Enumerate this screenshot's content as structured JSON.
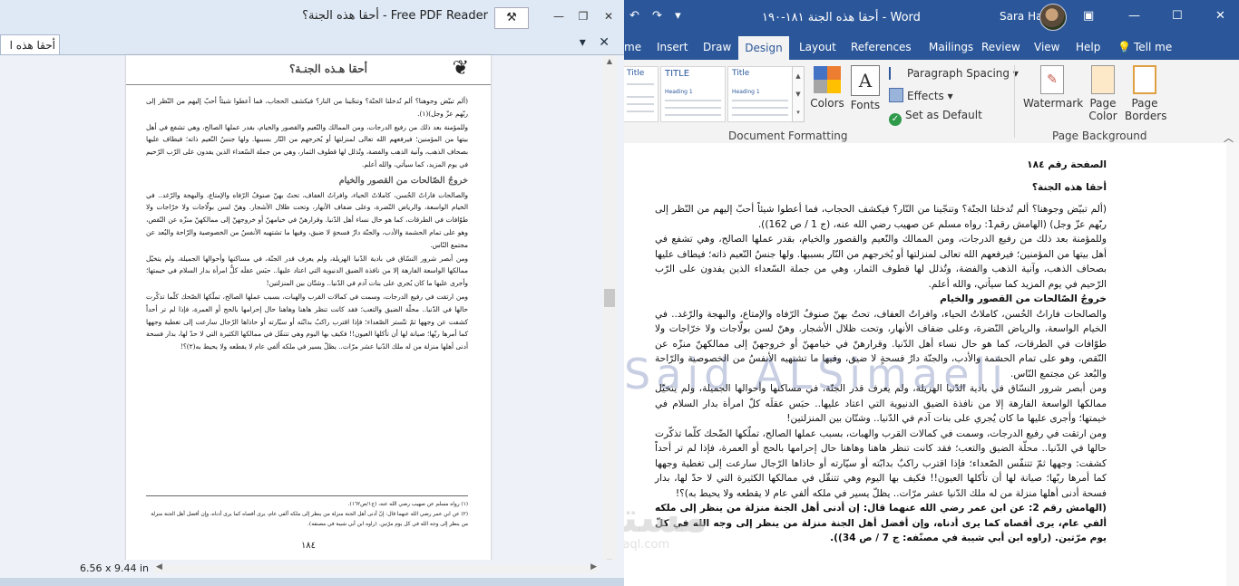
{
  "pdf": {
    "window_title": "أحقا هذه الجنة؟ - Free PDF Reader",
    "tab_label": "أحقا هذه ا",
    "page_header": "أحقا هـذه الجنـة؟",
    "paragraphs": [
      "(ألم تبيّض وجوهنا؟ ألم تُدخلنا الجنّة؟ وتنجّينا من النار؟ فيكشف الحجاب، فما أعطوا شيئاً أحبّ إليهم من النّظر إلى ربّهم عزّ وجل)(١).",
      "وللمؤمنة بعد ذلك من رفيع الدرجات، ومن الممالك والنّعيم والقصور والخيام، بقدر عملها الصالح، وهي تشفع في أهل بيتها من المؤمنين؛ فيرفعهم الله تعالى لمنزلتها أو يُخرجهم من النّار بسببها. ولها جنسُ النّعيم ذاته؛ فيطاف عليها بصحاف الذهب، وآنية الذهب والفضة، وتُذلل لها قطوف الثمار، وهي من جملة السّعداء الذين يفدون على الرّب الرّحيم في يوم المزيد، كما سيأتي، والله أعلم."
    ],
    "subheading": "خروجُ الصّالحات من القصور والخيام",
    "paragraphs2": [
      "والصالحات فاراتٌ الحُسن، كاملاتُ الحياء، وافراتُ العفاف، تحتُ بهنّ صنوفُ الرّفاه والإمتاع، والبهجة والرّغد.. في الخيام الواسعة، والرياض النّضرة، وعلى ضفاف الأنهار، وتحت ظلال الأشجار. وهنّ لسن بولّاجات ولا خرّاجات ولا طوّافات في الطرقات، كما هو حال نساء أهل الدّنيا. وقرارهنّ في خيامهنّ أو خروجهنّ إلى ممالكهنّ منزّه عن النّقص، وهو على تمام الحشمة والأدب، والجنّة دارُ فسحةٍ لا ضيق، وفيها ما تشتهيه الأنفسُ من الخصوصية والرّاحة والبُعد عن مجتمع النّاس.",
      "ومن أبصر شرور النسّاق في بادية الدّنيا الهزيلة، ولم يعرف قدر الجنّة، في مساكنها وأحوالها الجميلة، ولم يتخيّل ممالكها الواسعة الفارهة إلا من نافذة الضيق الدنيوية التي اعتاد عليها.. حبَس عقلَه كلُّ امرأة بدار السلام في خيمتها؛ وأجرى عليها ما كان يُجري على بنات آدم في الدّنيا.. وشتّان بين المنزلتين!",
      "ومن ارتقت في رفيع الدرجات، وسمت في كمالات القرب والهبات، بسبب عملها الصالح، تملّكها الصّحك كلّما تذكّرت حالها في الدّنيا.. محلّة الضيق والتعب؛ فقد كانت تنظر هاهنا وهاهنا حال إحرامها بالحج أو العمرة، فإذا لم تر أحداً كشفت عن وجهها ثمّ تتّستر الصّعداء؛ فإذا اقترب راكبٌ بدابّته أو سيّارته أو حاذاها الرّجال سارعت إلى تغطية وجهها كما أمرها ربّها؛ صيانة لها أن تأكلها العيون!! فكيف بها اليوم وهي تتنقّل في ممالكها الكثيرة التي لا حدّ لها، بدار فسحة أدنى أهلها منزلة من له ملك الدّنيا عشر مرّات.. يظلّ يسير في ملكه ألفي عام لا يقطعه ولا يحيط به(٢)؟!"
    ],
    "footnotes": [
      "(١) رواه مسلم عن صهيب رضي الله عنه، (ج١/ص١٦٢).",
      "(٢) عن ابن عمر رضي الله عنهما قال: إنّ أدنى أهل الجنة منزلة من ينظر إلى ملكه ألفي عام، يرى أقصاه كما يرى أدناه، وإن أفضل أهل الجنة منزلة من ينظر إلى وجه الله في كل يوم مرّتين. (راوه ابن أبي شيبة في مصنفه)."
    ],
    "page_number": "١٨٤",
    "page_size": "6.56 x 9.44 in"
  },
  "word": {
    "doc_title": "أحقا هذه الجنة ١٨١-١٩٠ - Word",
    "user_name": "Sara Hamdi",
    "ribbon_tabs": [
      "me",
      "Insert",
      "Draw",
      "Design",
      "Layout",
      "References",
      "Mailings",
      "Review",
      "View",
      "Help",
      "Tell me"
    ],
    "active_tab": "Design",
    "gallery": [
      {
        "title": "Title",
        "heading": "Heading 1"
      },
      {
        "title": "TITLE",
        "heading": "Heading 1"
      },
      {
        "title": "Title",
        "heading": "Heading 1"
      }
    ],
    "colors_label": "Colors",
    "fonts_label": "Fonts",
    "paragraph_spacing_label": "Paragraph Spacing",
    "effects_label": "Effects",
    "set_default_label": "Set as Default",
    "group_document_formatting": "Document Formatting",
    "watermark_label": "Watermark",
    "page_color_label": "Page Color",
    "page_borders_label": "Page Borders",
    "group_page_background": "Page Background",
    "watermark_text": "Said ALSimaeli",
    "mostaql_logo": "مستقل",
    "mostaql_url": "mostaql.com",
    "lines": [
      {
        "text": "الصفحة رقم ١٨٤",
        "bold": true
      },
      {
        "text": "",
        "gap": true
      },
      {
        "text": "أحقا هذه الجنة؟",
        "bold": true
      },
      {
        "text": "",
        "gap": true
      },
      {
        "text": "(ألم تبيّض وجوهنا؟ ألم تُدخلنا الجنّة؟ وتنجّينا من النّار؟ فيكشف الحجاب، فما أعطوا شيئاً أحبّ إليهم من النّظر إلى ربّهم عزّ وجل) (الهامش رقم1: رواه مسلم عن صهيب رضي الله عنه، (ج 1 / ص 162))."
      },
      {
        "text": "وللمؤمنة بعد ذلك من رفيع الدرجات، ومن الممالك والنّعيم والقصور والخيام، بقدر عملها الصالح، وهي تشفع في أهل بيتها من المؤمنين؛ فيرفعهم الله تعالى لمنزلتها أو يُخرجهم من النّار بسببها. ولها جنسُ النّعيم ذاته؛ فيطاف عليها بصحاف الذهب، وآنية الذهب والفضة، وتُذلل لها قطوف الثمار، وهي من جملة السّعداء الذين يفدون على الرّب الرّحيم في يوم المزيد كما سيأتي، والله أعلم."
      },
      {
        "text": "خروجُ الصّالحات من القصور والخيام",
        "bold": true
      },
      {
        "text": "والصالحات فاراتُ الحُسن، كاملاتُ الحياء، وافراتُ العفاف، تحتُ بهنّ صنوفُ الرّفاه والإمتاع، والبهجة والرّغد.. في الخيام الواسعة، والرياض النّضرة، وعلى ضفاف الأنهار، وتحت ظلال الأشجار. وهنّ لسن بولّاجات ولا خرّاجات ولا طوّافات في الطرقات، كما هو حال نساء أهل الدّنيا. وقرارهنّ في خيامهنّ أو خروجهنّ إلى ممالكهنّ منزّه عن النّقص، وهو على تمام الحشمة والأدب، والجنّة دارُ فسحةٍ لا ضيق، وفيها ما تشتهيه الأنفسُ من الخصوصية والرّاحة والبُعد عن مجتمع النّاس."
      },
      {
        "text": "ومن أبصر شرور النسّاق في بادية الدّنيا الهزيلة، ولم يعرف قدر الجنّة، في مساكنها وأحوالها الجميلة، ولم يتخيّل ممالكها الواسعة الفارهة إلا من نافذة الضيق الدنيوية التي اعتاد عليها.. حبَس عقلَه كلّ امرأة بدار السلام في خيمتها؛ وأجرى عليها ما كان يُجري على بنات آدم في الدّنيا.. وشتّان بين المنزلتين!"
      },
      {
        "text": "ومن ارتقت في رفيع الدرجات، وسمت في كمالات القرب والهبات، بسبب عملها الصالح، تملّكها الضّحك كلّما تذكّرت حالها في الدّنيا.. محلّة الضيق والتعب؛ فقد كانت تنظر هاهنا وهاهنا حال إحرامها بالحج أو العمرة، فإذا لم تر أحداً كشفت: وجهها ثمّ تتنفّس الصّعداء؛ فإذا اقترب راكبٌ بدابّته أو سيّارته أو حاذاها الرّجال سارعت إلى تغطية وجهها كما أمرها ربّها؛ صيانة لها أن تأكلها العيون!! فكيف بها اليوم وهي تتنقّل في ممالكها الكثيرة التي لا حدّ لها، بدار فسحة أدنى أهلها منزلة من له ملك الدّنيا عشر مرّات.. يظلّ يسير في ملكه ألفي عام لا يقطعه ولا يحيط به)؟!"
      },
      {
        "text": "(الهامش رقم 2: عن ابن عمر رضي الله عنهما قال: إن أدنى أهل الجنة منزلة من ينظر إلى ملكه ألفي عام، يرى أقصاه كما يرى أدناه، وإن أفضل أهل الجنة منزلة من ينظر إلى وجه الله في كلّ يوم مرّتين. (راوه ابن أبي شيبة في مصنّفه: ج 7 / ص 34)).",
        "bold": true
      }
    ]
  },
  "colors": {
    "word_blue": "#2b579a",
    "pdf_title_bg": "#dfe9f5",
    "ribbon_bg": "#f3f3f3"
  }
}
